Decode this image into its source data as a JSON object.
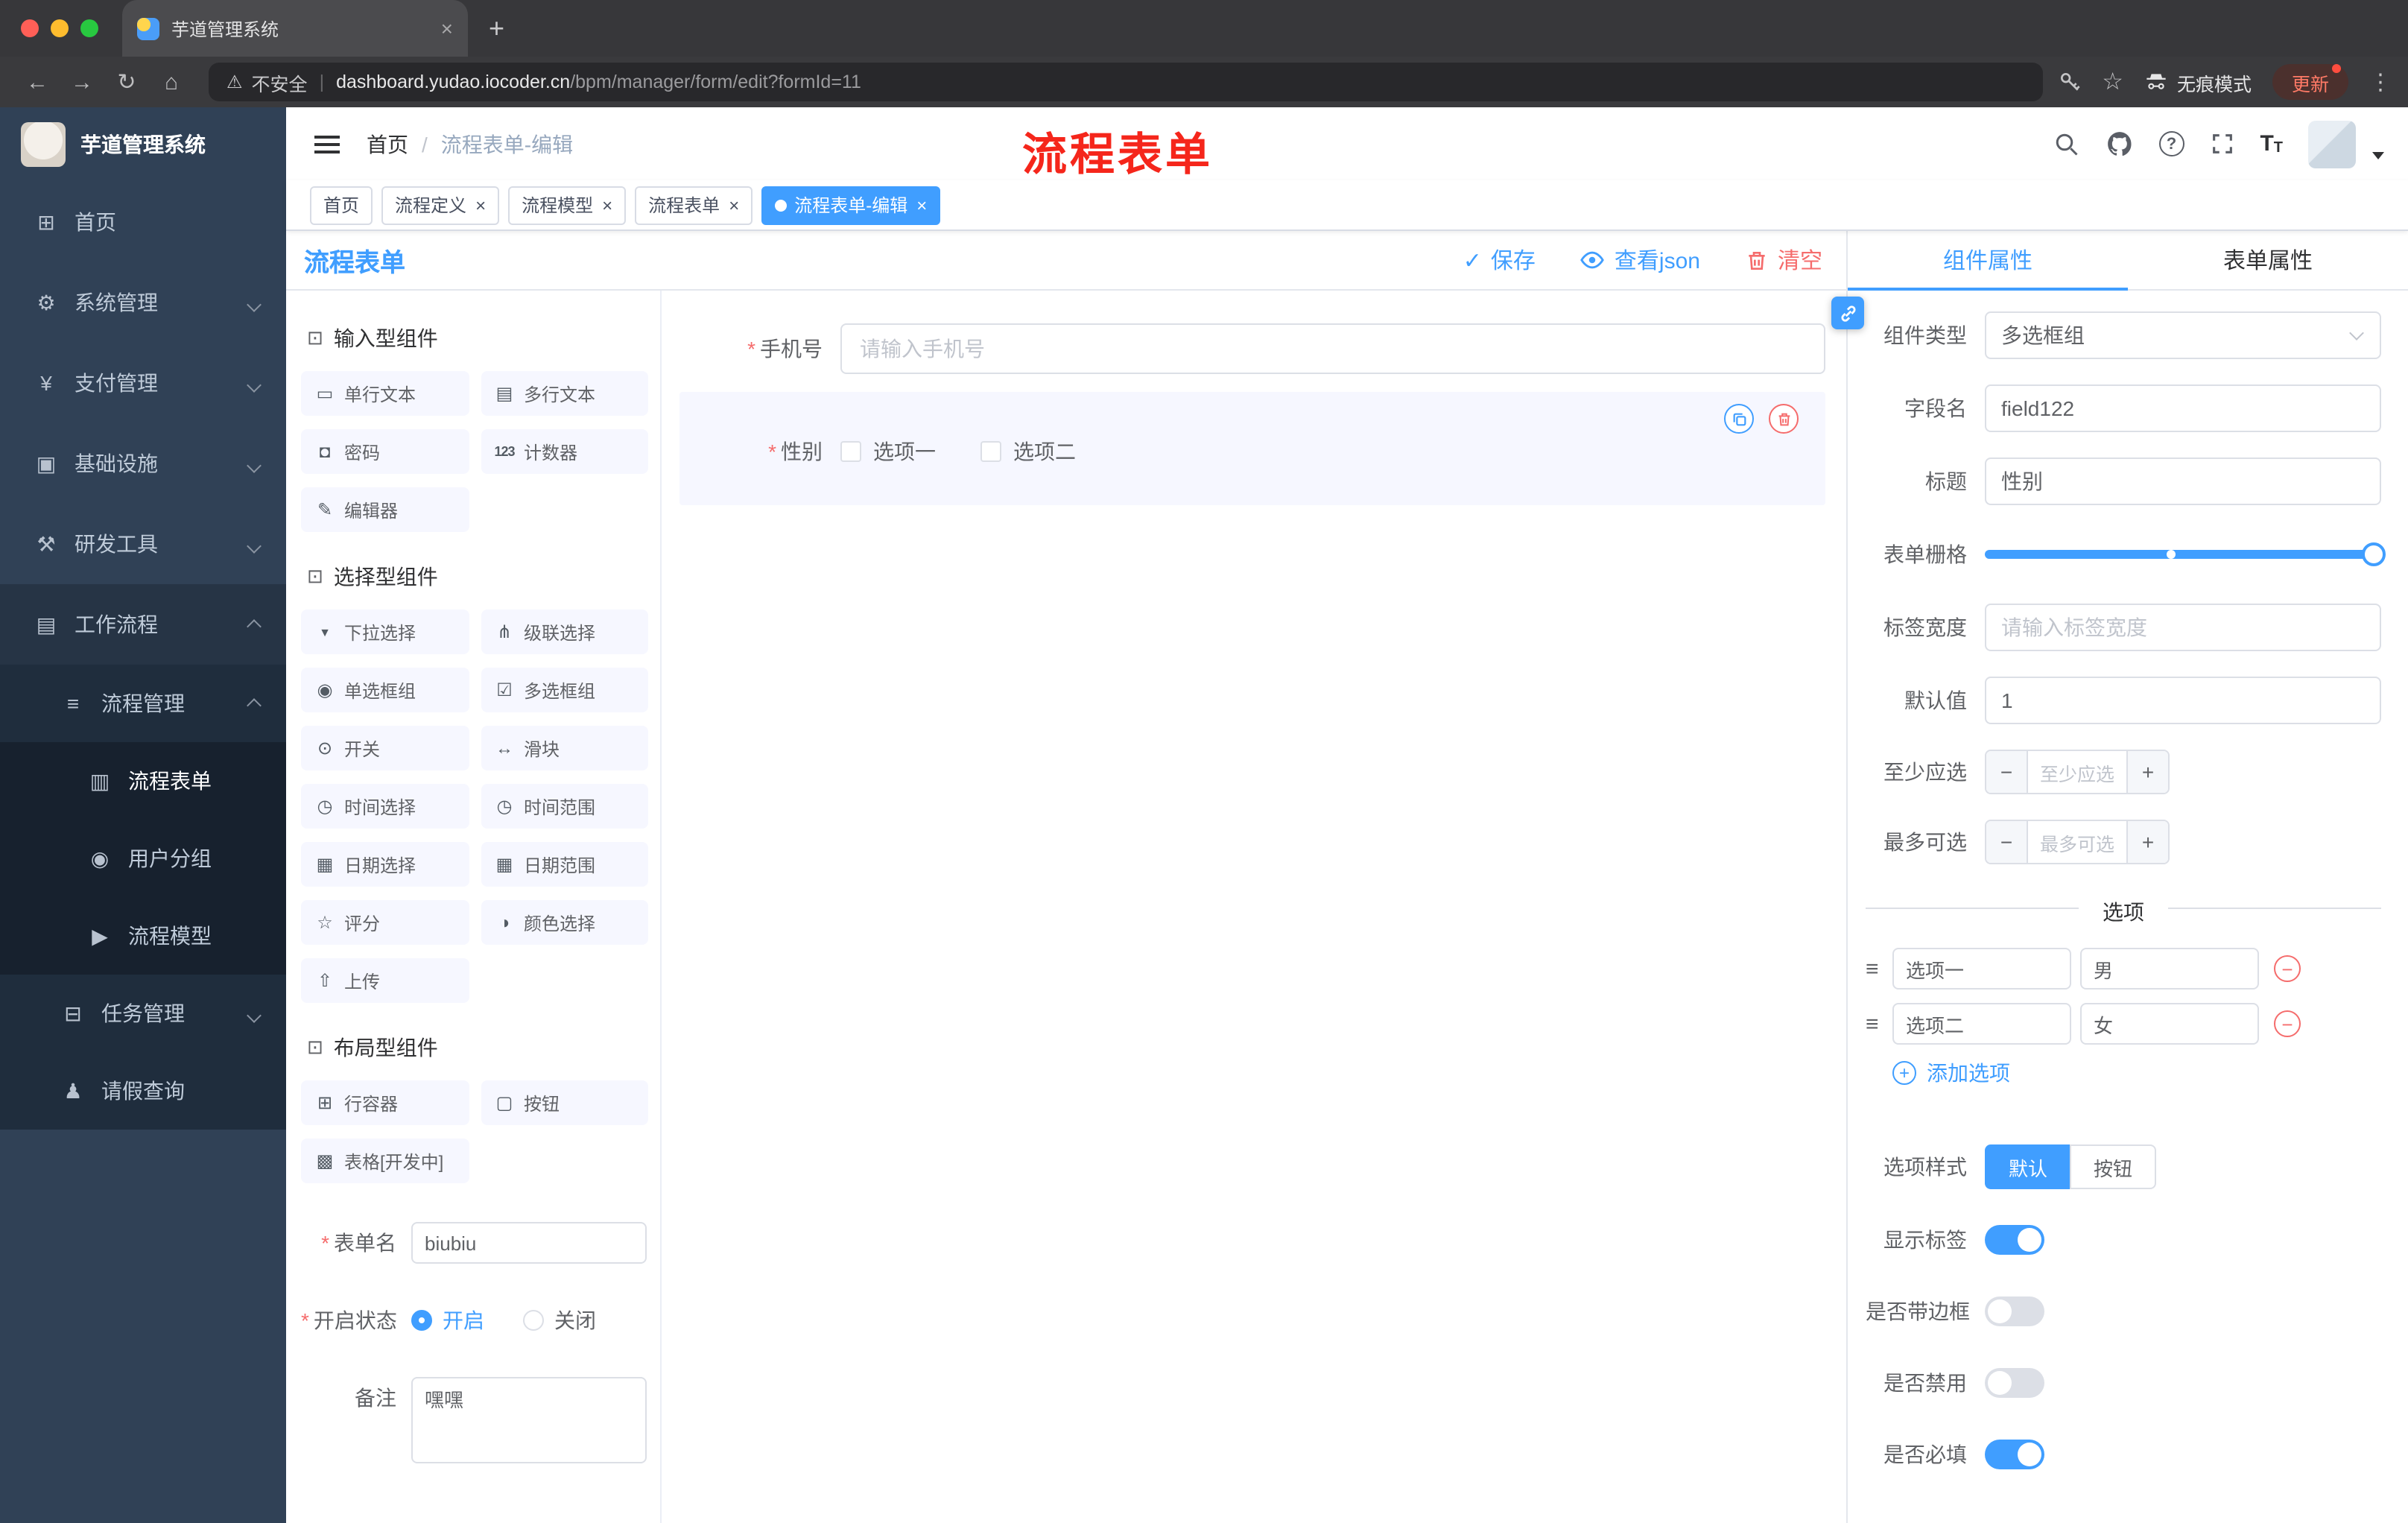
{
  "icons": {
    "close": "×",
    "new_tab": "+",
    "back": "←",
    "forward": "→",
    "reload": "↻",
    "home": "⌂",
    "warning": "⚠",
    "pipe": "|",
    "star": "☆",
    "menu_dots": "⋮",
    "slash": "/",
    "asterisk": "*",
    "check": "✓",
    "question": "?",
    "font_big": "T",
    "font_small": "T",
    "drag": "≡",
    "minus": "−",
    "plus": "+"
  },
  "palette_icons": {
    "section": "⊡",
    "single_text": "▭",
    "multi_text": "▤",
    "password": "◘",
    "counter": "123",
    "editor": "✎",
    "select": "▼",
    "cascader": "⋔",
    "radio": "◉",
    "checkbox": "☑",
    "switch": "⊙",
    "slider": "↔",
    "time": "◷",
    "time_range": "◷",
    "date": "▦",
    "date_range": "▦",
    "rate": "☆",
    "color": "◑",
    "upload": "⇧",
    "row": "⊞",
    "button": "▢",
    "table": "▩"
  },
  "sidebar_icons": {
    "home": "⊞",
    "system": "⚙",
    "pay": "¥",
    "infra": "▣",
    "dev": "⚒",
    "workflow": "▤",
    "proc_mgmt": "≡",
    "form": "▥",
    "group": "◉",
    "model": "▶",
    "task": "⊟",
    "person": "♟"
  },
  "browser": {
    "tab_title": "芋道管理系统",
    "security_label": "不安全",
    "url_domain": "dashboard.yudao.iocoder.cn",
    "url_path": "/bpm/manager/form/edit?formId=11",
    "incognito_label": "无痕模式",
    "update_label": "更新"
  },
  "sidebar": {
    "logo_title": "芋道管理系统",
    "items": [
      {
        "label": "首页"
      },
      {
        "label": "系统管理"
      },
      {
        "label": "支付管理"
      },
      {
        "label": "基础设施"
      },
      {
        "label": "研发工具"
      },
      {
        "label": "工作流程"
      },
      {
        "label": "流程管理"
      },
      {
        "label": "流程表单"
      },
      {
        "label": "用户分组"
      },
      {
        "label": "流程模型"
      },
      {
        "label": "任务管理"
      },
      {
        "label": "请假查询"
      }
    ]
  },
  "header": {
    "breadcrumb_home": "首页",
    "breadcrumb_current": "流程表单-编辑",
    "annotation": "流程表单"
  },
  "tags": [
    {
      "label": "首页"
    },
    {
      "label": "流程定义"
    },
    {
      "label": "流程模型"
    },
    {
      "label": "流程表单"
    },
    {
      "label": "流程表单-编辑"
    }
  ],
  "designer": {
    "title": "流程表单",
    "save_label": "保存",
    "view_json_label": "查看json",
    "clear_label": "清空"
  },
  "palette": {
    "sections": [
      {
        "title": "输入型组件",
        "items": [
          {
            "label": "单行文本"
          },
          {
            "label": "多行文本"
          },
          {
            "label": "密码"
          },
          {
            "label": "计数器"
          },
          {
            "label": "编辑器"
          }
        ]
      },
      {
        "title": "选择型组件",
        "items": [
          {
            "label": "下拉选择"
          },
          {
            "label": "级联选择"
          },
          {
            "label": "单选框组"
          },
          {
            "label": "多选框组"
          },
          {
            "label": "开关"
          },
          {
            "label": "滑块"
          },
          {
            "label": "时间选择"
          },
          {
            "label": "时间范围"
          },
          {
            "label": "日期选择"
          },
          {
            "label": "日期范围"
          },
          {
            "label": "评分"
          },
          {
            "label": "颜色选择"
          },
          {
            "label": "上传"
          }
        ]
      },
      {
        "title": "布局型组件",
        "items": [
          {
            "label": "行容器"
          },
          {
            "label": "按钮"
          },
          {
            "label": "表格[开发中]"
          }
        ]
      }
    ]
  },
  "form_meta": {
    "name_label": "表单名",
    "name_value": "biubiu",
    "status_label": "开启状态",
    "status_on": "开启",
    "status_off": "关闭",
    "remark_label": "备注",
    "remark_value": "嘿嘿"
  },
  "canvas": {
    "phone_field": {
      "label": "手机号",
      "placeholder": "请输入手机号"
    },
    "gender_field": {
      "label": "性别",
      "option1": "选项一",
      "option2": "选项二"
    }
  },
  "properties": {
    "tab_component": "组件属性",
    "tab_form": "表单属性",
    "component_type_label": "组件类型",
    "component_type_value": "多选框组",
    "field_name_label": "字段名",
    "field_name_value": "field122",
    "title_label": "标题",
    "title_value": "性别",
    "grid_label": "表单栅格",
    "label_width_label": "标签宽度",
    "label_width_placeholder": "请输入标签宽度",
    "default_label": "默认值",
    "default_value": "1",
    "min_label": "至少应选",
    "min_placeholder": "至少应选",
    "max_label": "最多可选",
    "max_placeholder": "最多可选",
    "options_title": "选项",
    "options": [
      {
        "label": "选项一",
        "value": "男"
      },
      {
        "label": "选项二",
        "value": "女"
      }
    ],
    "add_option_label": "添加选项",
    "option_style_label": "选项样式",
    "option_style_default": "默认",
    "option_style_button": "按钮",
    "show_label_label": "显示标签",
    "border_label": "是否带边框",
    "disabled_label": "是否禁用",
    "required_label": "是否必填"
  }
}
